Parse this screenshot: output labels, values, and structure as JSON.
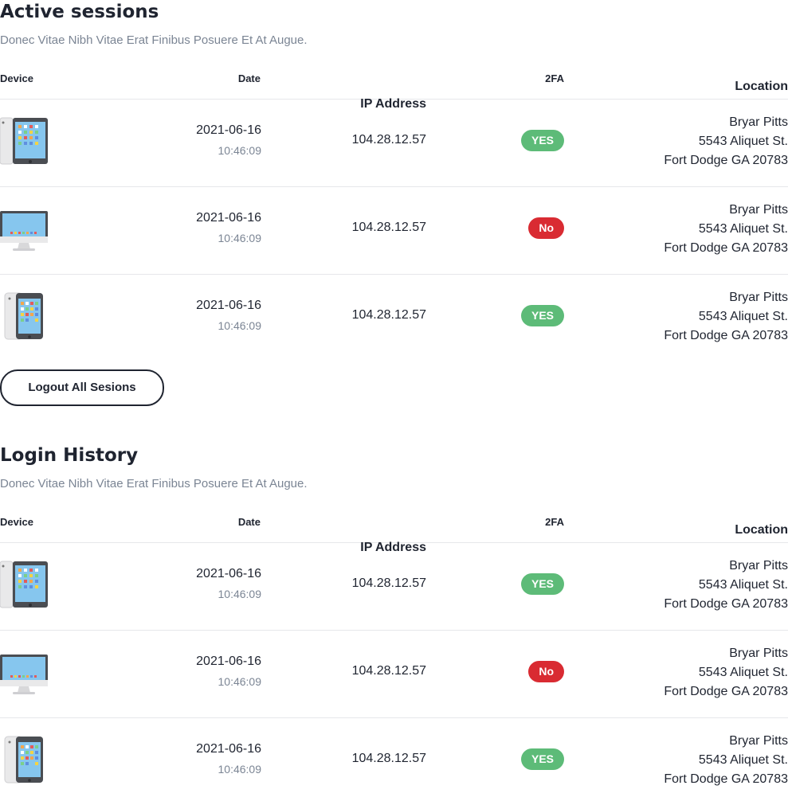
{
  "active_sessions": {
    "title": "Active sessions",
    "subtitle": "Donec Vitae Nibh Vitae Erat Finibus Posuere Et At Augue.",
    "columns": {
      "device": "Device",
      "date": "Date",
      "ip": "IP Address",
      "tfa": "2FA",
      "location": "Location"
    },
    "rows": [
      {
        "device": "tablet-icon",
        "date": "2021-06-16",
        "time": "10:46:09",
        "ip": "104.28.12.57",
        "tfa": "YES",
        "tfa_color": "#5dbb78",
        "loc1": "Bryar Pitts",
        "loc2": "5543 Aliquet St.",
        "loc3": "Fort Dodge GA 20783"
      },
      {
        "device": "desktop-icon",
        "date": "2021-06-16",
        "time": "10:46:09",
        "ip": "104.28.12.57",
        "tfa": "No",
        "tfa_color": "#d92b32",
        "loc1": "Bryar Pitts",
        "loc2": "5543 Aliquet St.",
        "loc3": "Fort Dodge GA 20783"
      },
      {
        "device": "phone-icon",
        "date": "2021-06-16",
        "time": "10:46:09",
        "ip": "104.28.12.57",
        "tfa": "YES",
        "tfa_color": "#5dbb78",
        "loc1": "Bryar Pitts",
        "loc2": "5543 Aliquet St.",
        "loc3": "Fort Dodge GA 20783"
      }
    ],
    "logout_label": "Logout All Sesions"
  },
  "login_history": {
    "title": "Login History",
    "subtitle": "Donec Vitae Nibh Vitae Erat Finibus Posuere Et At Augue.",
    "columns": {
      "device": "Device",
      "date": "Date",
      "ip": "IP Address",
      "tfa": "2FA",
      "location": "Location"
    },
    "rows": [
      {
        "device": "tablet-icon",
        "date": "2021-06-16",
        "time": "10:46:09",
        "ip": "104.28.12.57",
        "tfa": "YES",
        "tfa_color": "#5dbb78",
        "loc1": "Bryar Pitts",
        "loc2": "5543 Aliquet St.",
        "loc3": "Fort Dodge GA 20783"
      },
      {
        "device": "desktop-icon",
        "date": "2021-06-16",
        "time": "10:46:09",
        "ip": "104.28.12.57",
        "tfa": "No",
        "tfa_color": "#d92b32",
        "loc1": "Bryar Pitts",
        "loc2": "5543 Aliquet St.",
        "loc3": "Fort Dodge GA 20783"
      },
      {
        "device": "phone-icon",
        "date": "2021-06-16",
        "time": "10:46:09",
        "ip": "104.28.12.57",
        "tfa": "YES",
        "tfa_color": "#5dbb78",
        "loc1": "Bryar Pitts",
        "loc2": "5543 Aliquet St.",
        "loc3": "Fort Dodge GA 20783"
      }
    ]
  }
}
